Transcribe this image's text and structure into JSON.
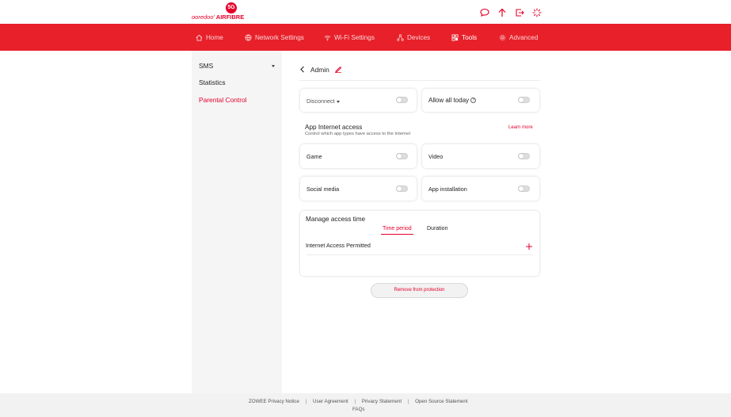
{
  "brand": {
    "badge": "5G",
    "name": "ooredoo'",
    "product": "AIRFIBRE",
    "accent_color": "#e4002b"
  },
  "top_icons": [
    "chat-icon",
    "upload-arrow-icon",
    "logout-icon",
    "loading-icon"
  ],
  "nav": [
    {
      "label": "Home",
      "icon": "home-icon"
    },
    {
      "label": "Network Settings",
      "icon": "globe-icon"
    },
    {
      "label": "Wi-Fi Settings",
      "icon": "wifi-icon"
    },
    {
      "label": "Devices",
      "icon": "devices-icon"
    },
    {
      "label": "Tools",
      "icon": "tools-icon",
      "active": true
    },
    {
      "label": "Advanced",
      "icon": "gear-icon"
    }
  ],
  "sidebar": {
    "items": [
      {
        "label": "SMS",
        "expandable": true
      },
      {
        "label": "Statistics"
      },
      {
        "label": "Parental Control",
        "active": true
      }
    ]
  },
  "header": {
    "device_name": "Admin"
  },
  "top_cards": {
    "disconnect": {
      "label": "Disconnect",
      "enabled": false
    },
    "allow_all_today": {
      "label": "Allow all today",
      "enabled": false
    }
  },
  "app_access": {
    "title": "App Internet access",
    "subtitle": "Control which app types have access to the Internet",
    "learn_more": "Learn more",
    "apps": [
      {
        "label": "Game",
        "enabled": false
      },
      {
        "label": "Video",
        "enabled": false
      },
      {
        "label": "Social media",
        "enabled": false
      },
      {
        "label": "App installation",
        "enabled": false
      }
    ]
  },
  "access_time": {
    "title": "Manage access time",
    "tabs": [
      "Time period",
      "Duration"
    ],
    "active_tab": "Time period",
    "row_label": "Internet Access Permitted"
  },
  "remove_button": "Remove from protection",
  "footer": {
    "links": [
      "ZOWEE Privacy Notice",
      "User Agreement",
      "Privacy Statement",
      "Open Source Statement"
    ],
    "separator": "|",
    "faq": "FAQs"
  }
}
